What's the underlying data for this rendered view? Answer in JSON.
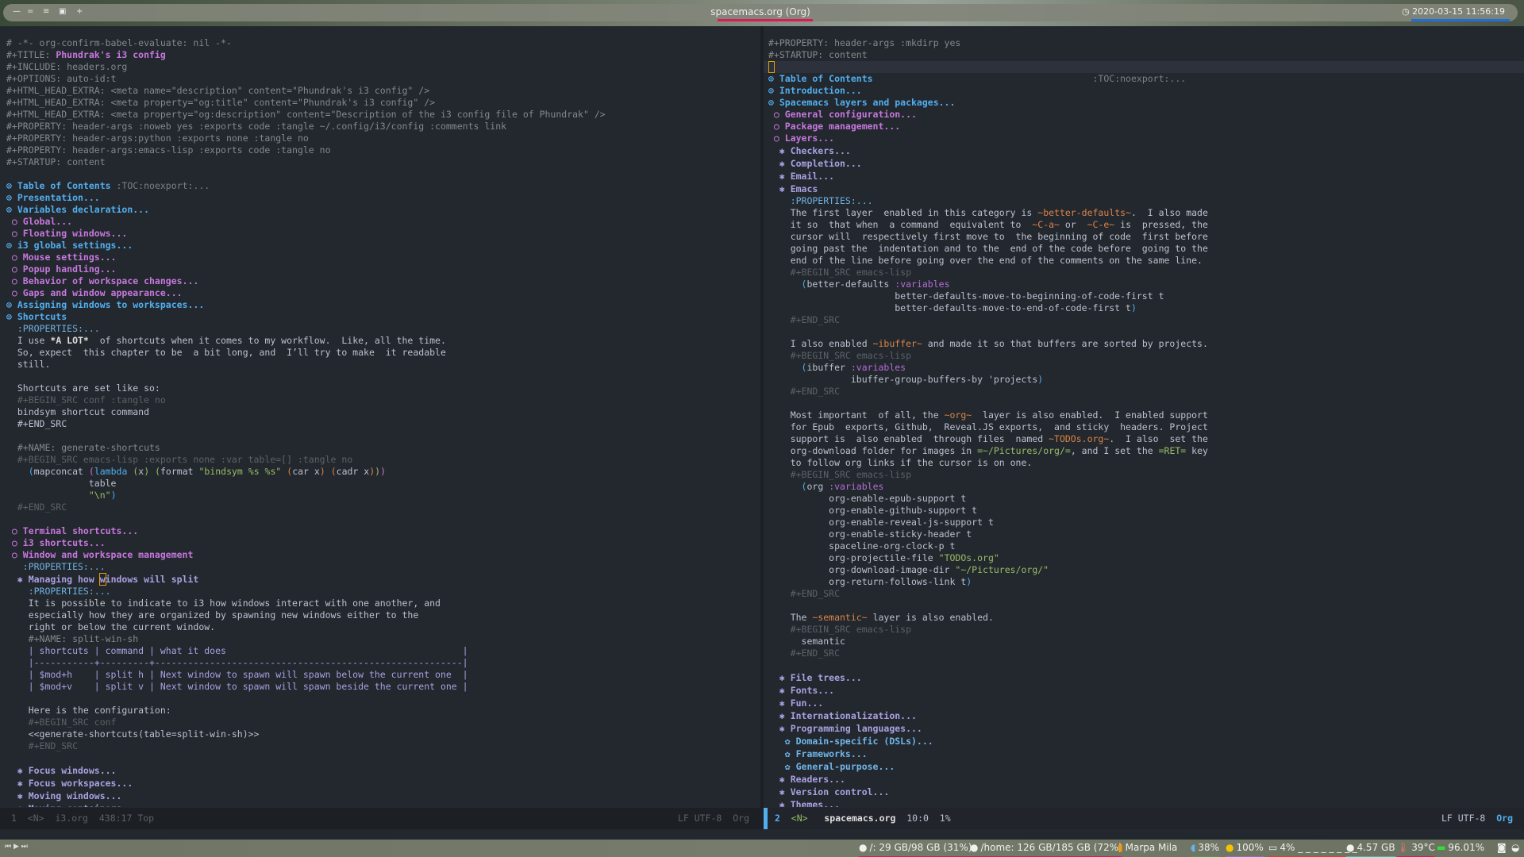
{
  "topbar": {
    "title": "spacemacs.org (Org)",
    "clock": "2020-03-15 11:56:19",
    "title_underline": "#e0185a",
    "clock_underline": "#1d6fe0",
    "workspace_icons": [
      "minus",
      "equals",
      "menu",
      "window",
      "plus"
    ]
  },
  "colors": {
    "bg": "#23272e",
    "h1": "#51afef",
    "h2": "#c678dd",
    "h3": "#a9a1e1",
    "comment": "#5b6268",
    "text": "#bbc2cf",
    "orange": "#da8548",
    "green": "#98be65",
    "cursor": "#e6a000"
  },
  "left": {
    "lines": [
      [
        {
          "t": "# -*- org-confirm-babel-evaluate: nil -*-",
          "s": "m"
        }
      ],
      [
        {
          "t": "#+TITLE: ",
          "s": "m"
        },
        {
          "t": "Phundrak's i3 config",
          "s": "title"
        }
      ],
      [
        {
          "t": "#+INCLUDE: headers.org",
          "s": "m"
        }
      ],
      [
        {
          "t": "#+OPTIONS: auto-id:t",
          "s": "m"
        }
      ],
      [
        {
          "t": "#+HTML_HEAD_EXTRA: <meta name=\"description\" content=\"Phundrak's i3 config\" />",
          "s": "m"
        }
      ],
      [
        {
          "t": "#+HTML_HEAD_EXTRA: <meta property=\"og:title\" content=\"Phundrak's i3 config\" />",
          "s": "m"
        }
      ],
      [
        {
          "t": "#+HTML_HEAD_EXTRA: <meta property=\"og:description\" content=\"Description of the i3 config file of Phundrak\" />",
          "s": "m"
        }
      ],
      [
        {
          "t": "#+PROPERTY: header-args :noweb yes :exports code :tangle ~/.config/i3/config :comments link",
          "s": "m"
        }
      ],
      [
        {
          "t": "#+PROPERTY: header-args:python :exports none :tangle no",
          "s": "m"
        }
      ],
      [
        {
          "t": "#+PROPERTY: header-args:emacs-lisp :exports code :tangle no",
          "s": "m"
        }
      ],
      [
        {
          "t": "#+STARTUP: content",
          "s": "m"
        }
      ],
      [],
      [
        {
          "t": "⊙ Table of Contents",
          "s": "h1"
        },
        {
          "t": " :TOC:noexport:...",
          "s": "tag"
        }
      ],
      [
        {
          "t": "⊙ Presentation...",
          "s": "h1"
        }
      ],
      [
        {
          "t": "⊙ Variables declaration...",
          "s": "h1"
        }
      ],
      [
        {
          "t": " ○ Global...",
          "s": "h2"
        }
      ],
      [
        {
          "t": " ○ Floating windows...",
          "s": "h2"
        }
      ],
      [
        {
          "t": "⊙ i3 global settings...",
          "s": "h1"
        }
      ],
      [
        {
          "t": " ○ Mouse settings...",
          "s": "h2"
        }
      ],
      [
        {
          "t": " ○ Popup handling...",
          "s": "h2"
        }
      ],
      [
        {
          "t": " ○ Behavior of workspace changes...",
          "s": "h2"
        }
      ],
      [
        {
          "t": " ○ Gaps and window appearance...",
          "s": "h2"
        }
      ],
      [
        {
          "t": "⊙ Assigning windows to workspaces...",
          "s": "h1"
        }
      ],
      [
        {
          "t": "⊙ Shortcuts",
          "s": "h1"
        }
      ],
      [
        {
          "t": "  :PROPERTIES:...",
          "s": "prop"
        }
      ],
      [
        {
          "t": "  I use ",
          "s": "t"
        },
        {
          "t": "*A LOT*",
          "s": "bd"
        },
        {
          "t": "  of shortcuts when it comes to my workflow.  Like, all the time.",
          "s": "t"
        }
      ],
      [
        {
          "t": "  So, expect  this chapter to be  a bit long, and  I’ll try to make  it readable",
          "s": "t"
        }
      ],
      [
        {
          "t": "  still.",
          "s": "t"
        }
      ],
      [],
      [
        {
          "t": "  Shortcuts are set like so:",
          "s": "t"
        }
      ],
      [
        {
          "t": "  #+BEGIN_SRC conf :tangle no",
          "s": "c"
        }
      ],
      [
        {
          "t": "  bindsym shortcut command",
          "s": "t"
        }
      ],
      [
        {
          "t": "  #+END_SRC",
          "s": "t"
        }
      ],
      [],
      [
        {
          "t": "  #+NAME: generate-shortcuts",
          "s": "m"
        }
      ],
      [
        {
          "t": "  #+BEGIN_SRC emacs-lisp :exports none :var table=[] :tangle no",
          "s": "c"
        }
      ],
      [
        {
          "t": "    ",
          "s": "t"
        },
        {
          "t": "(",
          "s": "pb"
        },
        {
          "t": "mapconcat ",
          "s": "t"
        },
        {
          "t": "(",
          "s": "pp"
        },
        {
          "t": "lambda",
          "s": "pb"
        },
        {
          "t": " ",
          "s": "t"
        },
        {
          "t": "(",
          "s": "pg"
        },
        {
          "t": "x",
          "s": "t"
        },
        {
          "t": ")",
          "s": "pg"
        },
        {
          "t": " ",
          "s": "t"
        },
        {
          "t": "(",
          "s": "pg"
        },
        {
          "t": "format ",
          "s": "t"
        },
        {
          "t": "\"bindsym %s %s\"",
          "s": "g"
        },
        {
          "t": " ",
          "s": "t"
        },
        {
          "t": "(",
          "s": "po"
        },
        {
          "t": "car x",
          "s": "t"
        },
        {
          "t": ")",
          "s": "po"
        },
        {
          "t": " ",
          "s": "t"
        },
        {
          "t": "(",
          "s": "po"
        },
        {
          "t": "cadr x",
          "s": "t"
        },
        {
          "t": ")",
          "s": "po"
        },
        {
          "t": ")",
          "s": "pg"
        },
        {
          "t": ")",
          "s": "pp"
        }
      ],
      [
        {
          "t": "               table",
          "s": "t"
        }
      ],
      [
        {
          "t": "               ",
          "s": "t"
        },
        {
          "t": "\"\\n\"",
          "s": "g"
        },
        {
          "t": ")",
          "s": "pb"
        }
      ],
      [
        {
          "t": "  #+END_SRC",
          "s": "c"
        }
      ],
      [],
      [
        {
          "t": " ○ Terminal shortcuts...",
          "s": "h2"
        }
      ],
      [
        {
          "t": " ○ i3 shortcuts...",
          "s": "h2"
        }
      ],
      [
        {
          "t": " ○ Window and workspace management",
          "s": "h2"
        }
      ],
      [
        {
          "t": "   :PROPERTIES:...",
          "s": "prop"
        }
      ],
      [
        {
          "t": "  ✱ Managing how ",
          "s": "h3"
        },
        {
          "t": "w",
          "s": "h3 ccur"
        },
        {
          "t": "indows will split",
          "s": "h3"
        }
      ],
      [
        {
          "t": "    :PROPERTIES:...",
          "s": "prop"
        }
      ],
      [
        {
          "t": "    It is possible to indicate to i3 how windows interact with one another, and",
          "s": "t"
        }
      ],
      [
        {
          "t": "    especially how they are organized by spawning new windows either to the",
          "s": "t"
        }
      ],
      [
        {
          "t": "    right or below the current window.",
          "s": "t"
        }
      ],
      [
        {
          "t": "    #+NAME: split-win-sh",
          "s": "m"
        }
      ],
      [
        {
          "t": "    | shortcuts | command | what it does                                           |",
          "s": "tbl"
        }
      ],
      [
        {
          "t": "    |-----------+---------+--------------------------------------------------------|",
          "s": "tbl"
        }
      ],
      [
        {
          "t": "    | $mod+h    | split h | Next window to spawn will spawn below the current one  |",
          "s": "tbl"
        }
      ],
      [
        {
          "t": "    | $mod+v    | split v | Next window to spawn will spawn beside the current one |",
          "s": "tbl"
        }
      ],
      [],
      [
        {
          "t": "    Here is the configuration:",
          "s": "t"
        }
      ],
      [
        {
          "t": "    #+BEGIN_SRC conf",
          "s": "c"
        }
      ],
      [
        {
          "t": "    <<generate-shortcuts(table=split-win-sh)>>",
          "s": "t"
        }
      ],
      [
        {
          "t": "    #+END_SRC",
          "s": "c"
        }
      ],
      [],
      [
        {
          "t": "  ✱ Focus windows...",
          "s": "h3"
        }
      ],
      [
        {
          "t": "  ✱ Focus workspaces...",
          "s": "h3"
        }
      ],
      [
        {
          "t": "  ✱ Moving windows...",
          "s": "h3"
        }
      ],
      [
        {
          "t": "  ✱ Moving containers...",
          "s": "h3"
        }
      ]
    ]
  },
  "right": {
    "cursor_line": 2,
    "lines": [
      [
        {
          "t": "#+PROPERTY: header-args :mkdirp yes",
          "s": "m"
        }
      ],
      [
        {
          "t": "#+STARTUP: content",
          "s": "m"
        }
      ],
      [],
      [
        {
          "t": "⊙ Table of Contents",
          "s": "h1"
        },
        {
          "t": "                                        :TOC:noexport:...",
          "s": "tag"
        }
      ],
      [
        {
          "t": "⊙ Introduction...",
          "s": "h1"
        }
      ],
      [
        {
          "t": "⊙ Spacemacs layers and packages...",
          "s": "h1"
        }
      ],
      [
        {
          "t": " ○ General configuration...",
          "s": "h2"
        }
      ],
      [
        {
          "t": " ○ Package management...",
          "s": "h2"
        }
      ],
      [
        {
          "t": " ○ Layers...",
          "s": "h2"
        }
      ],
      [
        {
          "t": "  ✱ Checkers...",
          "s": "h3"
        }
      ],
      [
        {
          "t": "  ✱ Completion...",
          "s": "h3"
        }
      ],
      [
        {
          "t": "  ✱ Email...",
          "s": "h3"
        }
      ],
      [
        {
          "t": "  ✱ Emacs",
          "s": "h3"
        }
      ],
      [
        {
          "t": "    :PROPERTIES:...",
          "s": "prop"
        }
      ],
      [
        {
          "t": "    The first layer  enabled in this category is ",
          "s": "t"
        },
        {
          "t": "~better-defaults~",
          "s": "o"
        },
        {
          "t": ".  I also made",
          "s": "t"
        }
      ],
      [
        {
          "t": "    it so  that when  a command  equivalent to  ",
          "s": "t"
        },
        {
          "t": "~C-a~",
          "s": "o"
        },
        {
          "t": " or  ",
          "s": "t"
        },
        {
          "t": "~C-e~",
          "s": "o"
        },
        {
          "t": " is  pressed, the",
          "s": "t"
        }
      ],
      [
        {
          "t": "    cursor will  respectively first move to  the beginning of code  first before",
          "s": "t"
        }
      ],
      [
        {
          "t": "    going past the  indentation and to the  end of the code before  going to the",
          "s": "t"
        }
      ],
      [
        {
          "t": "    end of the line before going over the end of the comments on the same line.",
          "s": "t"
        }
      ],
      [
        {
          "t": "    #+BEGIN_SRC emacs-lisp",
          "s": "c"
        }
      ],
      [
        {
          "t": "      ",
          "s": "t"
        },
        {
          "t": "(",
          "s": "pb"
        },
        {
          "t": "better-defaults ",
          "s": "t"
        },
        {
          "t": ":variables",
          "s": "kw"
        }
      ],
      [
        {
          "t": "                       better-defaults-move-to-beginning-of-code-first t",
          "s": "t"
        }
      ],
      [
        {
          "t": "                       better-defaults-move-to-end-of-code-first t",
          "s": "t"
        },
        {
          "t": ")",
          "s": "pb"
        }
      ],
      [
        {
          "t": "    #+END_SRC",
          "s": "c"
        }
      ],
      [],
      [
        {
          "t": "    I also enabled ",
          "s": "t"
        },
        {
          "t": "~ibuffer~",
          "s": "o"
        },
        {
          "t": " and made it so that buffers are sorted by projects.",
          "s": "t"
        }
      ],
      [
        {
          "t": "    #+BEGIN_SRC emacs-lisp",
          "s": "c"
        }
      ],
      [
        {
          "t": "      ",
          "s": "t"
        },
        {
          "t": "(",
          "s": "pb"
        },
        {
          "t": "ibuffer ",
          "s": "t"
        },
        {
          "t": ":variables",
          "s": "kw"
        }
      ],
      [
        {
          "t": "               ibuffer-group-buffers-by 'projects",
          "s": "t"
        },
        {
          "t": ")",
          "s": "pb"
        }
      ],
      [
        {
          "t": "    #+END_SRC",
          "s": "c"
        }
      ],
      [],
      [
        {
          "t": "    Most important  of all, the ",
          "s": "t"
        },
        {
          "t": "~org~",
          "s": "o"
        },
        {
          "t": "  layer is also enabled.  I enabled support",
          "s": "t"
        }
      ],
      [
        {
          "t": "    for Epub  exports, Github,  Reveal.JS exports,  and sticky  headers. Project",
          "s": "t"
        }
      ],
      [
        {
          "t": "    support is  also enabled  through files  named ",
          "s": "t"
        },
        {
          "t": "~TODOs.org~",
          "s": "o"
        },
        {
          "t": ".  I also  set the",
          "s": "t"
        }
      ],
      [
        {
          "t": "    org-download folder for images in ",
          "s": "t"
        },
        {
          "t": "=~/Pictures/org/=",
          "s": "g"
        },
        {
          "t": ", and I set the ",
          "s": "t"
        },
        {
          "t": "=RET=",
          "s": "g"
        },
        {
          "t": " key",
          "s": "t"
        }
      ],
      [
        {
          "t": "    to follow org links if the cursor is on one.",
          "s": "t"
        }
      ],
      [
        {
          "t": "    #+BEGIN_SRC emacs-lisp",
          "s": "c"
        }
      ],
      [
        {
          "t": "      ",
          "s": "t"
        },
        {
          "t": "(",
          "s": "pb"
        },
        {
          "t": "org ",
          "s": "t"
        },
        {
          "t": ":variables",
          "s": "kw"
        }
      ],
      [
        {
          "t": "           org-enable-epub-support t",
          "s": "t"
        }
      ],
      [
        {
          "t": "           org-enable-github-support t",
          "s": "t"
        }
      ],
      [
        {
          "t": "           org-enable-reveal-js-support t",
          "s": "t"
        }
      ],
      [
        {
          "t": "           org-enable-sticky-header t",
          "s": "t"
        }
      ],
      [
        {
          "t": "           spaceline-org-clock-p t",
          "s": "t"
        }
      ],
      [
        {
          "t": "           org-projectile-file ",
          "s": "t"
        },
        {
          "t": "\"TODOs.org\"",
          "s": "g"
        }
      ],
      [
        {
          "t": "           org-download-image-dir ",
          "s": "t"
        },
        {
          "t": "\"~/Pictures/org/\"",
          "s": "g"
        }
      ],
      [
        {
          "t": "           org-return-follows-link t",
          "s": "t"
        },
        {
          "t": ")",
          "s": "pb"
        }
      ],
      [
        {
          "t": "    #+END_SRC",
          "s": "c"
        }
      ],
      [],
      [
        {
          "t": "    The ",
          "s": "t"
        },
        {
          "t": "~semantic~",
          "s": "o"
        },
        {
          "t": " layer is also enabled.",
          "s": "t"
        }
      ],
      [
        {
          "t": "    #+BEGIN_SRC emacs-lisp",
          "s": "c"
        }
      ],
      [
        {
          "t": "      semantic",
          "s": "t"
        }
      ],
      [
        {
          "t": "    #+END_SRC",
          "s": "c"
        }
      ],
      [],
      [
        {
          "t": "  ✱ File trees...",
          "s": "h3"
        }
      ],
      [
        {
          "t": "  ✱ Fonts...",
          "s": "h3"
        }
      ],
      [
        {
          "t": "  ✱ Fun...",
          "s": "h3"
        }
      ],
      [
        {
          "t": "  ✱ Internationalization...",
          "s": "h3"
        }
      ],
      [
        {
          "t": "  ✱ Programming languages...",
          "s": "h3"
        }
      ],
      [
        {
          "t": "   ✿ Domain-specific (DSLs)...",
          "s": "h4"
        }
      ],
      [
        {
          "t": "   ✿ Frameworks...",
          "s": "h4"
        }
      ],
      [
        {
          "t": "   ✿ General-purpose...",
          "s": "h4"
        }
      ],
      [
        {
          "t": "  ✱ Readers...",
          "s": "h3"
        }
      ],
      [
        {
          "t": "  ✱ Version control...",
          "s": "h3"
        }
      ],
      [
        {
          "t": "  ✱ Themes...",
          "s": "h3"
        }
      ]
    ]
  },
  "modeline_left": {
    "window": "1",
    "state": "<N>",
    "buffer": "i3.org",
    "position": "438:17",
    "scroll": "Top",
    "eol": "LF",
    "encoding": "UTF-8",
    "mode": "Org"
  },
  "modeline_right": {
    "window": "2",
    "state": "<N>",
    "buffer": "spacemacs.org",
    "position": "10:0",
    "scroll": "1%",
    "eol": "LF",
    "encoding": "UTF-8",
    "mode": "Org",
    "accent": "#51afef"
  },
  "bottombar": {
    "media": "⏮ ▶ ⏭",
    "items": [
      {
        "icon": "disk-icon",
        "glyph": "●",
        "label": "/: 29 GB/98 GB (31%)",
        "underline": "#d81b60"
      },
      {
        "icon": "disk-icon",
        "glyph": "●",
        "label": "/home: 126 GB/185 GB (72%)",
        "underline": "#d81b60"
      },
      {
        "icon": "wifi-icon",
        "glyph": "▮",
        "label": "Marpa Mila",
        "underline": ""
      },
      {
        "icon": "volume-icon",
        "glyph": "◖",
        "label": "38%",
        "underline": "#43a047"
      },
      {
        "icon": "battery-icon",
        "glyph": "●",
        "label": "100%",
        "underline": "#8e6fc8"
      },
      {
        "icon": "cpu-icon",
        "glyph": "▭",
        "label": "4% _ _ _ _ _ _ _ _",
        "underline": "#e53935"
      },
      {
        "icon": "memory-icon",
        "glyph": "●",
        "label": "4.57 GB",
        "underline": "#26c6b0"
      },
      {
        "icon": "temperature-icon",
        "glyph": "🌡",
        "label": "39°C",
        "underline": "#d81b60"
      },
      {
        "icon": "battery-level-icon",
        "glyph": "▬",
        "label": "96.01%",
        "underline": ""
      }
    ]
  }
}
